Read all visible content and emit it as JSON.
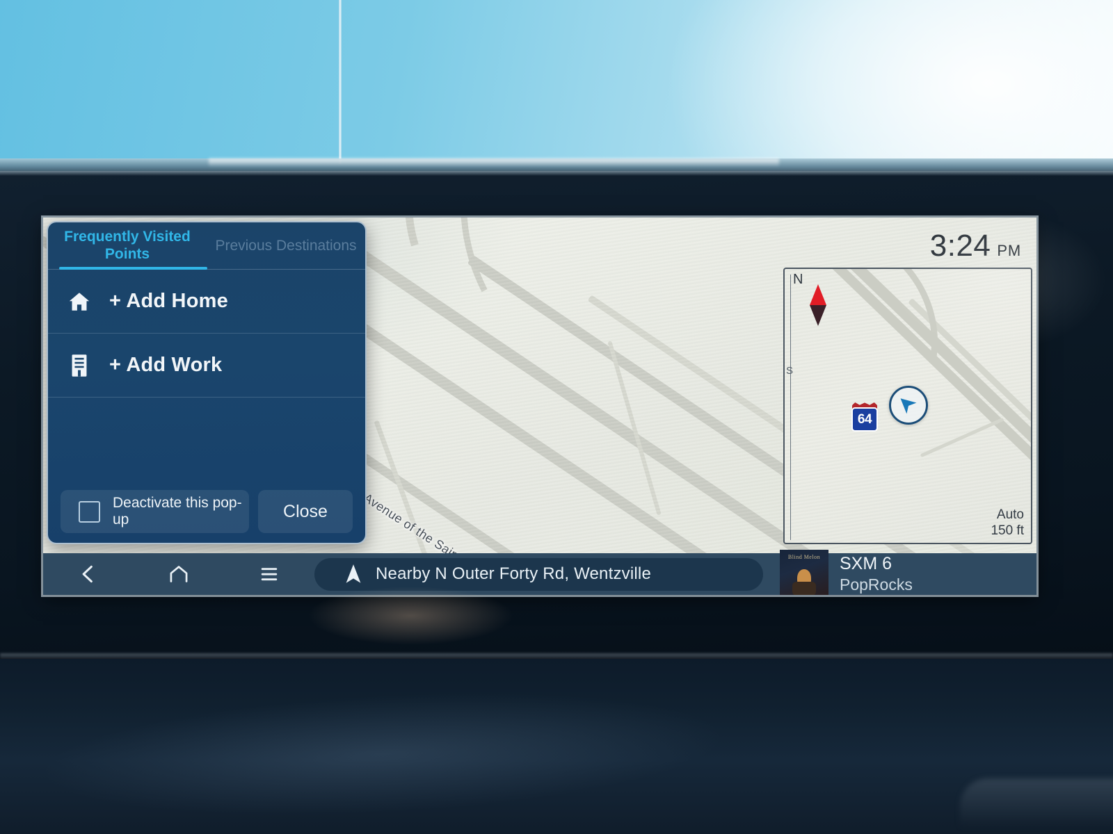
{
  "clock": {
    "time": "3:24",
    "meridiem": "PM"
  },
  "popup": {
    "tabs": [
      {
        "label": "Frequently Visited Points",
        "state": "active"
      },
      {
        "label": "Previous Destinations",
        "state": "inactive"
      }
    ],
    "rows": [
      {
        "icon": "home-icon",
        "label": "+ Add Home"
      },
      {
        "icon": "work-building-icon",
        "label": "+ Add Work"
      }
    ],
    "deactivate_checkbox_label": "Deactivate this pop-up",
    "deactivate_checked": false,
    "close_label": "Close"
  },
  "map": {
    "road_label": "Avenue of the Saints",
    "vehicle_marker": "vehicle-heading-arrow"
  },
  "minimap": {
    "compass_north": "N",
    "compass_south": "S",
    "highway_shield": "64",
    "scale_mode": "Auto",
    "scale_value": "150 ft"
  },
  "bottom_bar": {
    "nav_icons": [
      {
        "name": "back-icon",
        "label": "Back"
      },
      {
        "name": "home-icon",
        "label": "Home"
      },
      {
        "name": "menu-icon",
        "label": "Menu"
      }
    ],
    "address": "Nearby N Outer Forty Rd, Wentzville",
    "address_icon": "navigation-arrow-icon",
    "media": {
      "title": "SXM 6",
      "subtitle": "PopRocks",
      "album_art": "blind-melon-album-art",
      "album_art_text": "Blind Melon"
    }
  },
  "colors": {
    "accent": "#31b7e8",
    "panel_bg": "#1a456c",
    "bar_bg": "#2f4a61",
    "map_bg": "#e9eae4",
    "shield_blue": "#1b3fa0",
    "shield_red": "#b3262b",
    "compass_red": "#e11d26"
  }
}
